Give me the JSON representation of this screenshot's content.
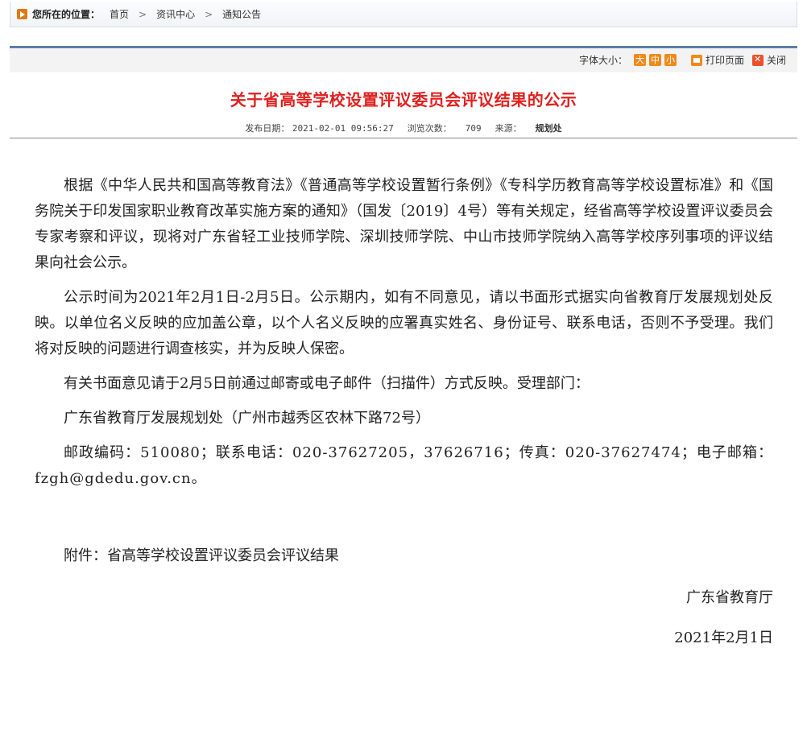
{
  "breadcrumb": {
    "label": "您所在的位置：",
    "items": [
      "首页",
      "资讯中心",
      "通知公告"
    ]
  },
  "toolbar": {
    "font_size_label": "字体大小：",
    "sizes": [
      "大",
      "中",
      "小"
    ],
    "print_label": "打印页面",
    "close_label": "关闭"
  },
  "article": {
    "title": "关于省高等学校设置评议委员会评议结果的公示",
    "meta": {
      "date_label": "发布日期：",
      "date_value": "2021-02-01 09:56:27",
      "views_label": "浏览次数：",
      "views_value": "709",
      "source_label": "来源：",
      "source_value": "规划处"
    },
    "paragraphs": [
      "根据《中华人民共和国高等教育法》《普通高等学校设置暂行条例》《专科学历教育高等学校设置标准》和《国务院关于印发国家职业教育改革实施方案的通知》（国发〔2019〕4号）等有关规定，经省高等学校设置评议委员会专家考察和评议，现将对广东省轻工业技师学院、深圳技师学院、中山市技师学院纳入高等学校序列事项的评议结果向社会公示。",
      "公示时间为2021年2月1日-2月5日。公示期内，如有不同意见，请以书面形式据实向省教育厅发展规划处反映。以单位名义反映的应加盖公章，以个人名义反映的应署真实姓名、身份证号、联系电话，否则不予受理。我们将对反映的问题进行调查核实，并为反映人保密。",
      "有关书面意见请于2月5日前通过邮寄或电子邮件（扫描件）方式反映。受理部门：",
      "广东省教育厅发展规划处（广州市越秀区农林下路72号）",
      "邮政编码：510080；联系电话：020-37627205，37626716；传真：020-37627474；电子邮箱：fzgh@gdedu.gov.cn。"
    ],
    "attachment": "附件：省高等学校设置评议委员会评议结果",
    "signature": "广东省教育厅",
    "sign_date": "2021年2月1日"
  }
}
